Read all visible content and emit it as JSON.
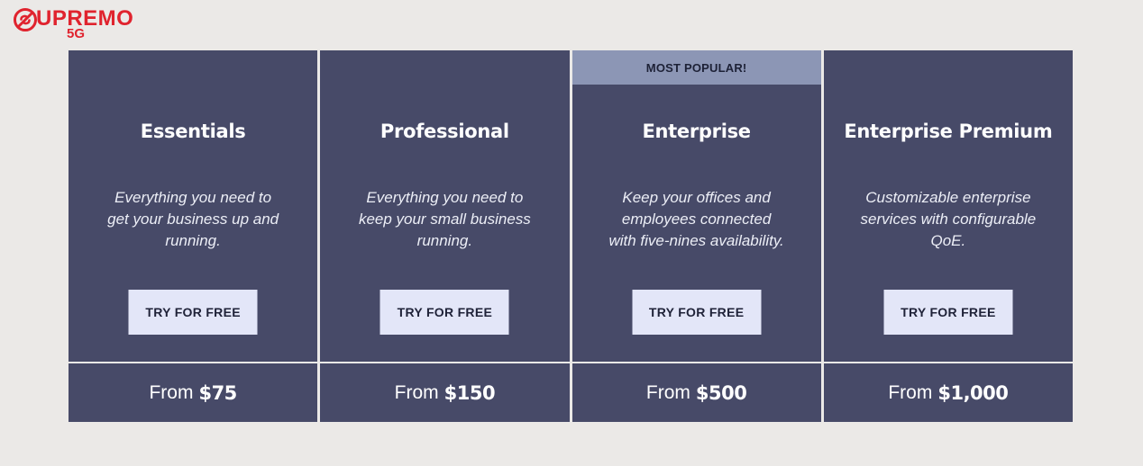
{
  "brand": {
    "name": "UPREMO",
    "sub": "5G",
    "color": "#e0232e",
    "icon": "slashed-s-circle-logo"
  },
  "colors": {
    "background": "#ebe9e7",
    "card": "#474a68",
    "badge": "#8c96b5",
    "button": "#e3e6f8"
  },
  "plans": [
    {
      "name": "Essentials",
      "description": "Everything you need to get your business up and running.",
      "button": "TRY FOR FREE",
      "price_prefix": "From",
      "price": "$75"
    },
    {
      "name": "Professional",
      "description": "Everything you need to keep your small business running.",
      "button": "TRY FOR FREE",
      "price_prefix": "From",
      "price": "$150"
    },
    {
      "name": "Enterprise",
      "badge": "MOST POPULAR!",
      "description": "Keep your offices and employees connected with five-nines availability.",
      "button": "TRY FOR FREE",
      "price_prefix": "From",
      "price": "$500"
    },
    {
      "name": "Enterprise Premium",
      "description": "Customizable enterprise services with configurable QoE.",
      "button": "TRY FOR FREE",
      "price_prefix": "From",
      "price": "$1,000"
    }
  ]
}
